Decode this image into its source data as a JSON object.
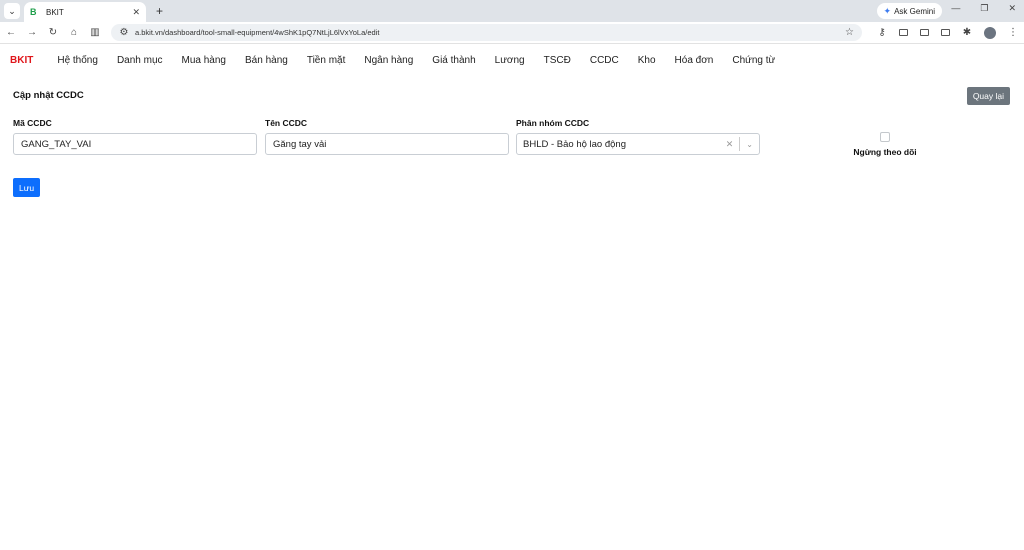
{
  "browser": {
    "tab_title": "BKIT",
    "tab_icon": "B",
    "url": "a.bkit.vn/dashboard/tool-small-equipment/4wShK1pQ7NtLjL6lVxYoLa/edit",
    "gemini_label": "Ask Gemini"
  },
  "nav": {
    "brand": "BKIT",
    "items": [
      "Hệ thống",
      "Danh mục",
      "Mua hàng",
      "Bán hàng",
      "Tiền mặt",
      "Ngân hàng",
      "Giá thành",
      "Lương",
      "TSCĐ",
      "CCDC",
      "Kho",
      "Hóa đơn",
      "Chứng từ"
    ]
  },
  "page": {
    "title": "Cập nhật CCDC",
    "back_label": "Quay lại",
    "save_label": "Lưu"
  },
  "form": {
    "code_label": "Mã CCDC",
    "code_value": "GANG_TAY_VAI",
    "name_label": "Tên CCDC",
    "name_value": "Găng tay vải",
    "group_label": "Phân nhóm CCDC",
    "group_value": "BHLD - Bảo hộ lao động",
    "inactive_label": "Ngừng theo dõi",
    "inactive_checked": false
  },
  "colors": {
    "brand": "#e0161b",
    "primary": "#0d6efd",
    "secondary": "#6c757d"
  }
}
